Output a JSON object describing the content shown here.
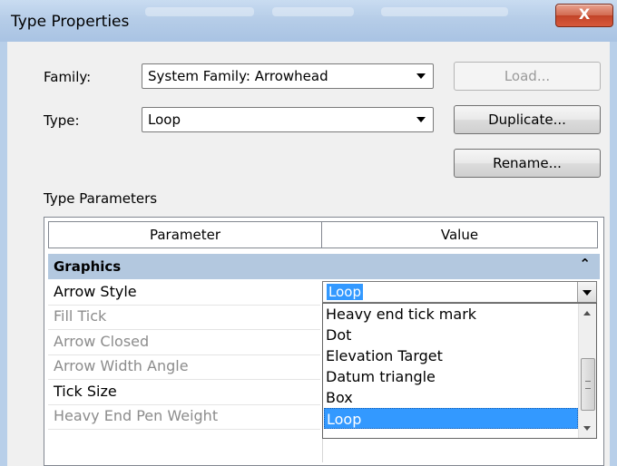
{
  "window": {
    "title": "Type Properties",
    "close_label": "X"
  },
  "family": {
    "label": "Family:",
    "value": "System Family: Arrowhead"
  },
  "type": {
    "label": "Type:",
    "value": "Loop"
  },
  "buttons": {
    "load": "Load...",
    "duplicate": "Duplicate...",
    "rename": "Rename..."
  },
  "type_parameters": {
    "label": "Type Parameters",
    "col_parameter": "Parameter",
    "col_value": "Value",
    "group": "Graphics",
    "group_toggle": "⌃",
    "rows": [
      {
        "name": "Arrow Style",
        "enabled": true
      },
      {
        "name": "Fill Tick",
        "enabled": false
      },
      {
        "name": "Arrow Closed",
        "enabled": false
      },
      {
        "name": "Arrow Width Angle",
        "enabled": false
      },
      {
        "name": "Tick Size",
        "enabled": true
      },
      {
        "name": "Heavy End Pen Weight",
        "enabled": false
      }
    ]
  },
  "arrow_style_dropdown": {
    "selected": "Loop",
    "options": [
      "Heavy end tick mark",
      "Dot",
      "Elevation Target",
      "Datum triangle",
      "Box",
      "Loop"
    ]
  },
  "colors": {
    "selection": "#3399ff",
    "group_header": "#b3c8df",
    "close_button": "#c24428"
  }
}
